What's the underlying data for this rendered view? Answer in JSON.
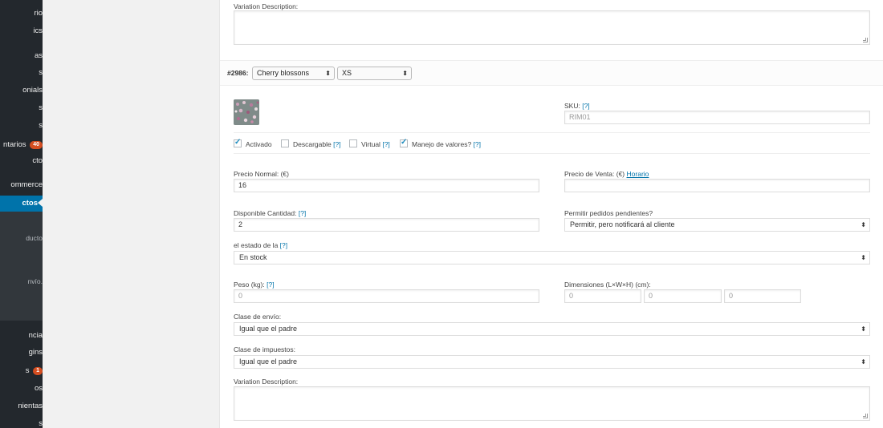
{
  "sidebar": {
    "items": [
      {
        "label": "rio"
      },
      {
        "label": "ics"
      },
      {
        "label": "as"
      },
      {
        "label": "s"
      },
      {
        "label": "onials"
      },
      {
        "label": "s"
      },
      {
        "label": "s"
      },
      {
        "label": "ntarios",
        "badge": "40"
      },
      {
        "label": "cto"
      },
      {
        "label": "ommerce"
      },
      {
        "label": "ctos"
      }
    ],
    "subitems": [
      {
        "label": "ducto"
      },
      {
        "label": "nvío."
      }
    ],
    "bottom_items": [
      {
        "label": "ncia"
      },
      {
        "label": "gins"
      },
      {
        "label": "s",
        "badge": "1"
      },
      {
        "label": "os"
      },
      {
        "label": "nientas"
      },
      {
        "label": "s"
      }
    ]
  },
  "top_variation_description": {
    "label": "Variation Description:"
  },
  "variation_header": {
    "id_label": "#2986:",
    "attribute1_value": "Cherry blossons",
    "attribute2_value": "XS"
  },
  "sku": {
    "label": "SKU:",
    "help": "[?]",
    "placeholder": "RIM01"
  },
  "checkboxes": [
    {
      "label": "Activado",
      "help": "",
      "checked": true
    },
    {
      "label": "Descargable",
      "help": "[?]",
      "checked": false
    },
    {
      "label": "Virtual",
      "help": "[?]",
      "checked": false
    },
    {
      "label": "Manejo de valores?",
      "help": "[?]",
      "checked": true
    }
  ],
  "regular_price": {
    "label": "Precio Normal: (€)",
    "value": "16"
  },
  "sale_price": {
    "label": "Precio de Venta: (€)",
    "link": "Horario",
    "value": ""
  },
  "stock_qty": {
    "label": "Disponible Cantidad:",
    "help": "[?]",
    "value": "2"
  },
  "backorders": {
    "label": "Permitir pedidos pendientes?",
    "value": "Permitir, pero notificará al cliente"
  },
  "stock_status": {
    "label": "el estado de la",
    "help": "[?]",
    "value": "En stock"
  },
  "weight": {
    "label": "Peso (kg):",
    "help": "[?]",
    "placeholder": "0"
  },
  "dimensions": {
    "label": "Dimensiones (L×W×H) (cm):",
    "placeholders": [
      "0",
      "0",
      "0"
    ]
  },
  "shipping_class": {
    "label": "Clase de envío:",
    "value": "Igual que el padre"
  },
  "tax_class": {
    "label": "Clase de impuestos:",
    "value": "Igual que el padre"
  },
  "variation_description": {
    "label": "Variation Description:"
  },
  "colors": {
    "sidebar_bg": "#23282d",
    "active": "#0073aa",
    "link": "#0073aa",
    "badge": "#d54e21"
  }
}
